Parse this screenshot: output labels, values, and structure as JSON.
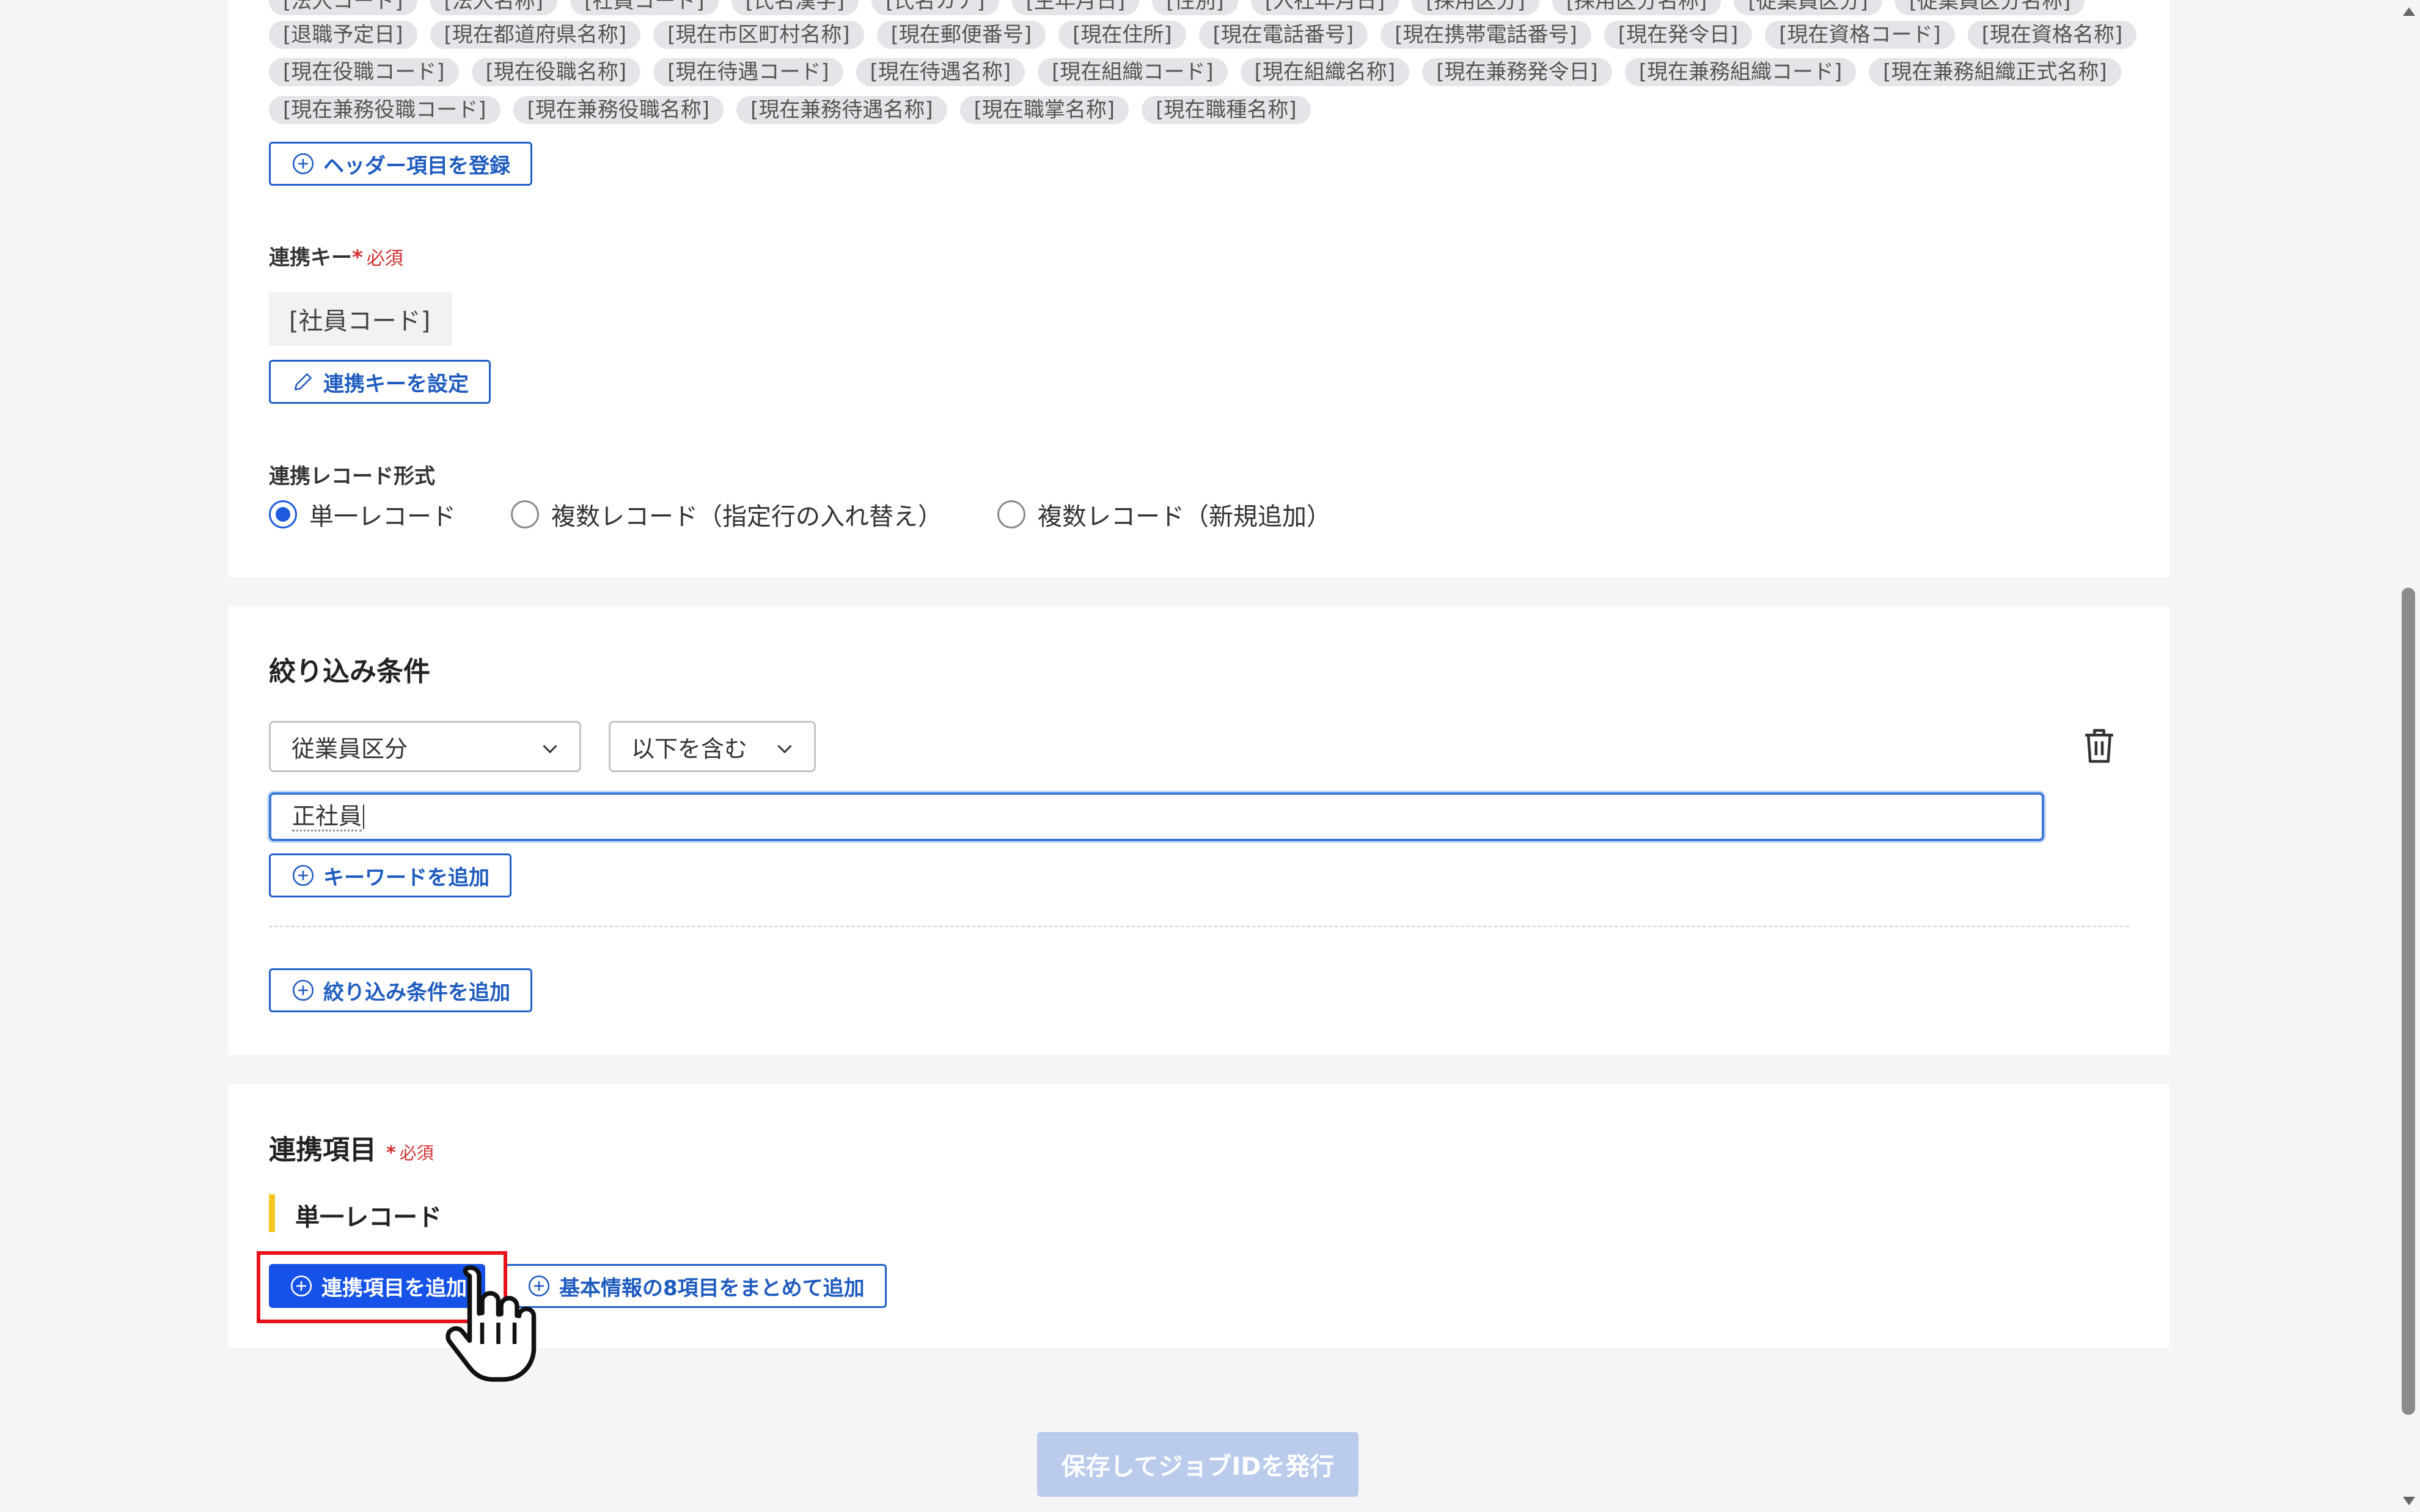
{
  "header_tags": {
    "row0": [
      "[法人コード]",
      "[法人名称]",
      "[社員コード]",
      "[氏名漢字]",
      "[氏名カナ]",
      "[生年月日]",
      "[性別]",
      "[入社年月日]",
      "[採用区分]",
      "[採用区分名称]",
      "[従業員区分]",
      "[従業員区分名称]"
    ],
    "row1": [
      "[退職予定日]",
      "[現在都道府県名称]",
      "[現在市区町村名称]",
      "[現在郵便番号]",
      "[現在住所]",
      "[現在電話番号]",
      "[現在携帯電話番号]",
      "[現在発令日]",
      "[現在資格コード]",
      "[現在資格名称]"
    ],
    "row2": [
      "[現在役職コード]",
      "[現在役職名称]",
      "[現在待遇コード]",
      "[現在待遇名称]",
      "[現在組織コード]",
      "[現在組織名称]",
      "[現在兼務発令日]",
      "[現在兼務組織コード]",
      "[現在兼務組織正式名称]"
    ],
    "row3": [
      "[現在兼務役職コード]",
      "[現在兼務役職名称]",
      "[現在兼務待遇名称]",
      "[現在職掌名称]",
      "[現在職種名称]"
    ]
  },
  "header_register_button": "ヘッダー項目を登録",
  "link_key": {
    "label": "連携キー",
    "required_mark": "*",
    "required_text": "必須",
    "value": "[社員コード]",
    "set_button": "連携キーを設定"
  },
  "record_format": {
    "label": "連携レコード形式",
    "options": [
      "単一レコード",
      "複数レコード（指定行の入れ替え）",
      "複数レコード（新規追加）"
    ],
    "selected_index": 0
  },
  "filter": {
    "title": "絞り込み条件",
    "field_select": "従業員区分",
    "operator_select": "以下を含む",
    "keyword_value": "正社員",
    "add_keyword_button": "キーワードを追加",
    "add_condition_button": "絞り込み条件を追加"
  },
  "link_items": {
    "title": "連携項目",
    "required_mark": "*",
    "required_text": "必須",
    "subsection": "単一レコード",
    "add_button": "連携項目を追加",
    "add_basic_button": "基本情報の8項目をまとめて追加"
  },
  "save_button": "保存してジョブIDを発行",
  "icons": {
    "plus": "plus-circle-icon",
    "pencil": "pencil-icon",
    "chevron": "chevron-down-icon",
    "trash": "trash-icon",
    "cursor": "hand-pointer-icon"
  },
  "colors": {
    "primary": "#1652e8",
    "outline": "#2060c8",
    "highlight": "#e8121c",
    "disabled": "#bacbec",
    "accent_bar": "#f5c623"
  }
}
